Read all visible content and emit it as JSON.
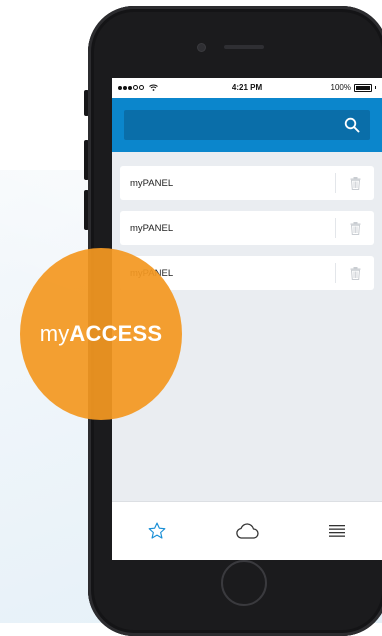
{
  "status_bar": {
    "time": "4:21 PM",
    "battery": "100%"
  },
  "search": {
    "placeholder": ""
  },
  "panels": [
    {
      "label": "myPANEL"
    },
    {
      "label": "myPANEL"
    },
    {
      "label": "myPANEL"
    }
  ],
  "tabs": [
    {
      "icon": "star-icon",
      "active": true
    },
    {
      "icon": "cloud-icon",
      "active": false
    },
    {
      "icon": "menu-icon",
      "active": false
    }
  ],
  "logo": {
    "prefix": "my",
    "suffix": "ACCESS"
  },
  "colors": {
    "accent": "#0b86cc",
    "logo": "#f39821"
  }
}
